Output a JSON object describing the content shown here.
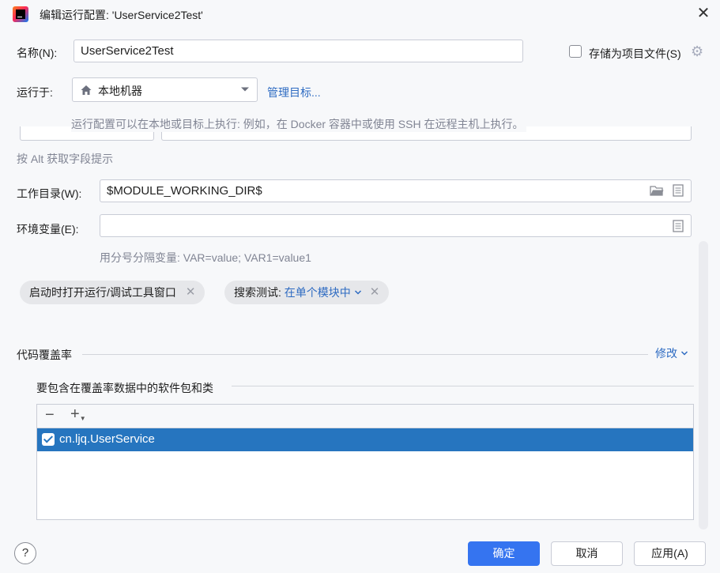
{
  "window": {
    "title": "编辑运行配置: 'UserService2Test'",
    "close_symbol": "✕"
  },
  "name_row": {
    "label": "名称(N):",
    "value": "UserService2Test",
    "store_label": "存储为项目文件(S)",
    "store_checked": false
  },
  "run_on": {
    "label": "运行于:",
    "selected": "本地机器",
    "manage_link": "管理目标...",
    "hint": "运行配置可以在本地或目标上执行: 例如，在 Docker 容器中或使用 SSH 在远程主机上执行。"
  },
  "alt_hint": "按 Alt 获取字段提示",
  "working_dir": {
    "label": "工作目录(W):",
    "value": "$MODULE_WORKING_DIR$"
  },
  "env_vars": {
    "label": "环境变量(E):",
    "value": "",
    "hint": "用分号分隔变量: VAR=value; VAR1=value1"
  },
  "chips": {
    "open_window": "启动时打开运行/调试工具窗口",
    "search_prefix": "搜索测试: ",
    "search_value": "在单个模块中"
  },
  "coverage": {
    "section_title": "代码覆盖率",
    "modify_link": "修改",
    "include_title": "要包含在覆盖率数据中的软件包和类",
    "toolbar_minus": "−",
    "toolbar_plus": "+",
    "items": [
      {
        "label": "cn.ljq.UserService",
        "checked": true,
        "selected": true
      }
    ]
  },
  "footer": {
    "help": "?",
    "ok": "确定",
    "cancel": "取消",
    "apply": "应用(A)"
  },
  "colors": {
    "primary": "#3574f0",
    "link": "#2e6bc2",
    "selection": "#2675bf"
  }
}
